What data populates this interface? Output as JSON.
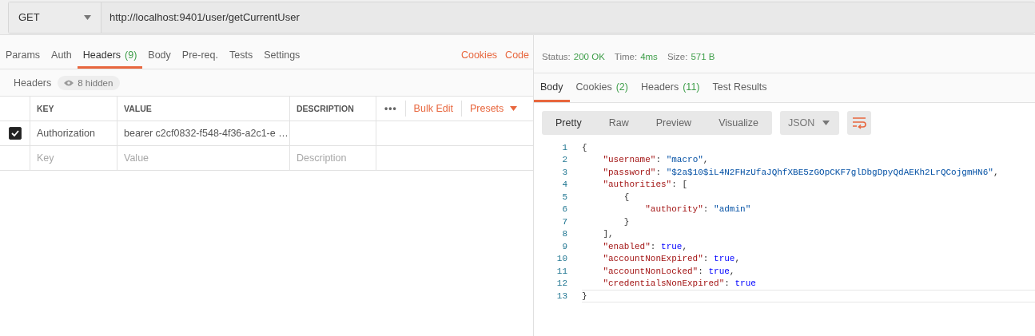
{
  "request": {
    "method": "GET",
    "url": "http://localhost:9401/user/getCurrentUser"
  },
  "request_tabs": [
    {
      "label": "Params",
      "selected": false
    },
    {
      "label": "Auth",
      "selected": false
    },
    {
      "label": "Headers",
      "count": "(9)",
      "selected": true
    },
    {
      "label": "Body",
      "selected": false
    },
    {
      "label": "Pre-req.",
      "selected": false
    },
    {
      "label": "Tests",
      "selected": false
    },
    {
      "label": "Settings",
      "selected": false
    }
  ],
  "request_links": [
    "Cookies",
    "Code"
  ],
  "headers_bar": {
    "title": "Headers",
    "hidden": "8 hidden"
  },
  "headers_table": {
    "columns": [
      "KEY",
      "VALUE",
      "DESCRIPTION"
    ],
    "more": "•••",
    "bulk_edit": "Bulk Edit",
    "presets": "Presets",
    "rows": [
      {
        "key": "Authorization",
        "value": "bearer c2cf0832-f548-4f36-a2c1-e …",
        "description": "",
        "checked": true
      }
    ],
    "placeholder_row": {
      "key": "Key",
      "value": "Value",
      "description": "Description"
    }
  },
  "response": {
    "status_label": "Status:",
    "status": "200 OK",
    "time_label": "Time:",
    "time": "4ms",
    "size_label": "Size:",
    "size": "571 B"
  },
  "response_tabs": [
    {
      "label": "Body",
      "selected": true
    },
    {
      "label": "Cookies",
      "count": "(2)",
      "selected": false
    },
    {
      "label": "Headers",
      "count": "(11)",
      "selected": false
    },
    {
      "label": "Test Results",
      "selected": false
    }
  ],
  "view_modes": [
    {
      "label": "Pretty",
      "selected": true
    },
    {
      "label": "Raw",
      "selected": false
    },
    {
      "label": "Preview",
      "selected": false
    },
    {
      "label": "Visualize",
      "selected": false
    }
  ],
  "format": "JSON",
  "code_lines": [
    {
      "number": "1",
      "current": false,
      "tokens": [
        {
          "kind": "punct",
          "text": "{"
        }
      ]
    },
    {
      "number": "2",
      "current": false,
      "tokens": [
        {
          "kind": "key",
          "text": "    \"username\""
        },
        {
          "kind": "punct",
          "text": ": "
        },
        {
          "kind": "string",
          "text": "\"macro\""
        },
        {
          "kind": "punct",
          "text": ","
        }
      ]
    },
    {
      "number": "3",
      "current": false,
      "tokens": [
        {
          "kind": "key",
          "text": "    \"password\""
        },
        {
          "kind": "punct",
          "text": ": "
        },
        {
          "kind": "string",
          "text": "\"$2a$10$iL4N2FHzUfaJQhfXBE5zGOpCKF7glDbgDpyQdAEKh2LrQCojgmHN6\""
        },
        {
          "kind": "punct",
          "text": ","
        }
      ]
    },
    {
      "number": "4",
      "current": false,
      "tokens": [
        {
          "kind": "key",
          "text": "    \"authorities\""
        },
        {
          "kind": "punct",
          "text": ": ["
        }
      ]
    },
    {
      "number": "5",
      "current": false,
      "tokens": [
        {
          "kind": "punct",
          "text": "        {"
        }
      ]
    },
    {
      "number": "6",
      "current": false,
      "tokens": [
        {
          "kind": "key",
          "text": "            \"authority\""
        },
        {
          "kind": "punct",
          "text": ": "
        },
        {
          "kind": "string",
          "text": "\"admin\""
        }
      ]
    },
    {
      "number": "7",
      "current": false,
      "tokens": [
        {
          "kind": "punct",
          "text": "        }"
        }
      ]
    },
    {
      "number": "8",
      "current": false,
      "tokens": [
        {
          "kind": "punct",
          "text": "    ],"
        }
      ]
    },
    {
      "number": "9",
      "current": false,
      "tokens": [
        {
          "kind": "key",
          "text": "    \"enabled\""
        },
        {
          "kind": "punct",
          "text": ": "
        },
        {
          "kind": "bool",
          "text": "true"
        },
        {
          "kind": "punct",
          "text": ","
        }
      ]
    },
    {
      "number": "10",
      "current": false,
      "tokens": [
        {
          "kind": "key",
          "text": "    \"accountNonExpired\""
        },
        {
          "kind": "punct",
          "text": ": "
        },
        {
          "kind": "bool",
          "text": "true"
        },
        {
          "kind": "punct",
          "text": ","
        }
      ]
    },
    {
      "number": "11",
      "current": false,
      "tokens": [
        {
          "kind": "key",
          "text": "    \"accountNonLocked\""
        },
        {
          "kind": "punct",
          "text": ": "
        },
        {
          "kind": "bool",
          "text": "true"
        },
        {
          "kind": "punct",
          "text": ","
        }
      ]
    },
    {
      "number": "12",
      "current": false,
      "tokens": [
        {
          "kind": "key",
          "text": "    \"credentialsNonExpired\""
        },
        {
          "kind": "punct",
          "text": ": "
        },
        {
          "kind": "bool",
          "text": "true"
        }
      ]
    },
    {
      "number": "13",
      "current": true,
      "tokens": [
        {
          "kind": "punct",
          "text": "}"
        }
      ]
    }
  ]
}
